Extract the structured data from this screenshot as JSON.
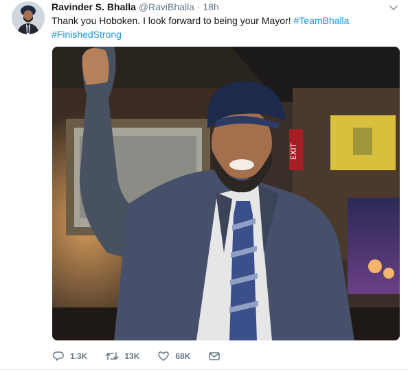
{
  "tweet": {
    "author_name": "Ravinder S. Bhalla",
    "handle": "@RaviBhalla",
    "separator": "·",
    "time": "18h",
    "text_plain": "Thank you Hoboken. I look forward to being your Mayor! ",
    "hashtags": [
      "#TeamBhalla",
      "#FinishedStrong"
    ],
    "media_description": "photo"
  },
  "actions": {
    "reply_count": "1.3K",
    "retweet_count": "13K",
    "like_count": "68K"
  },
  "colors": {
    "link": "#1b95e0",
    "muted": "#657786",
    "text": "#14171a"
  },
  "icons": [
    "chevron-down-icon",
    "reply-icon",
    "retweet-icon",
    "like-icon",
    "dm-icon"
  ]
}
